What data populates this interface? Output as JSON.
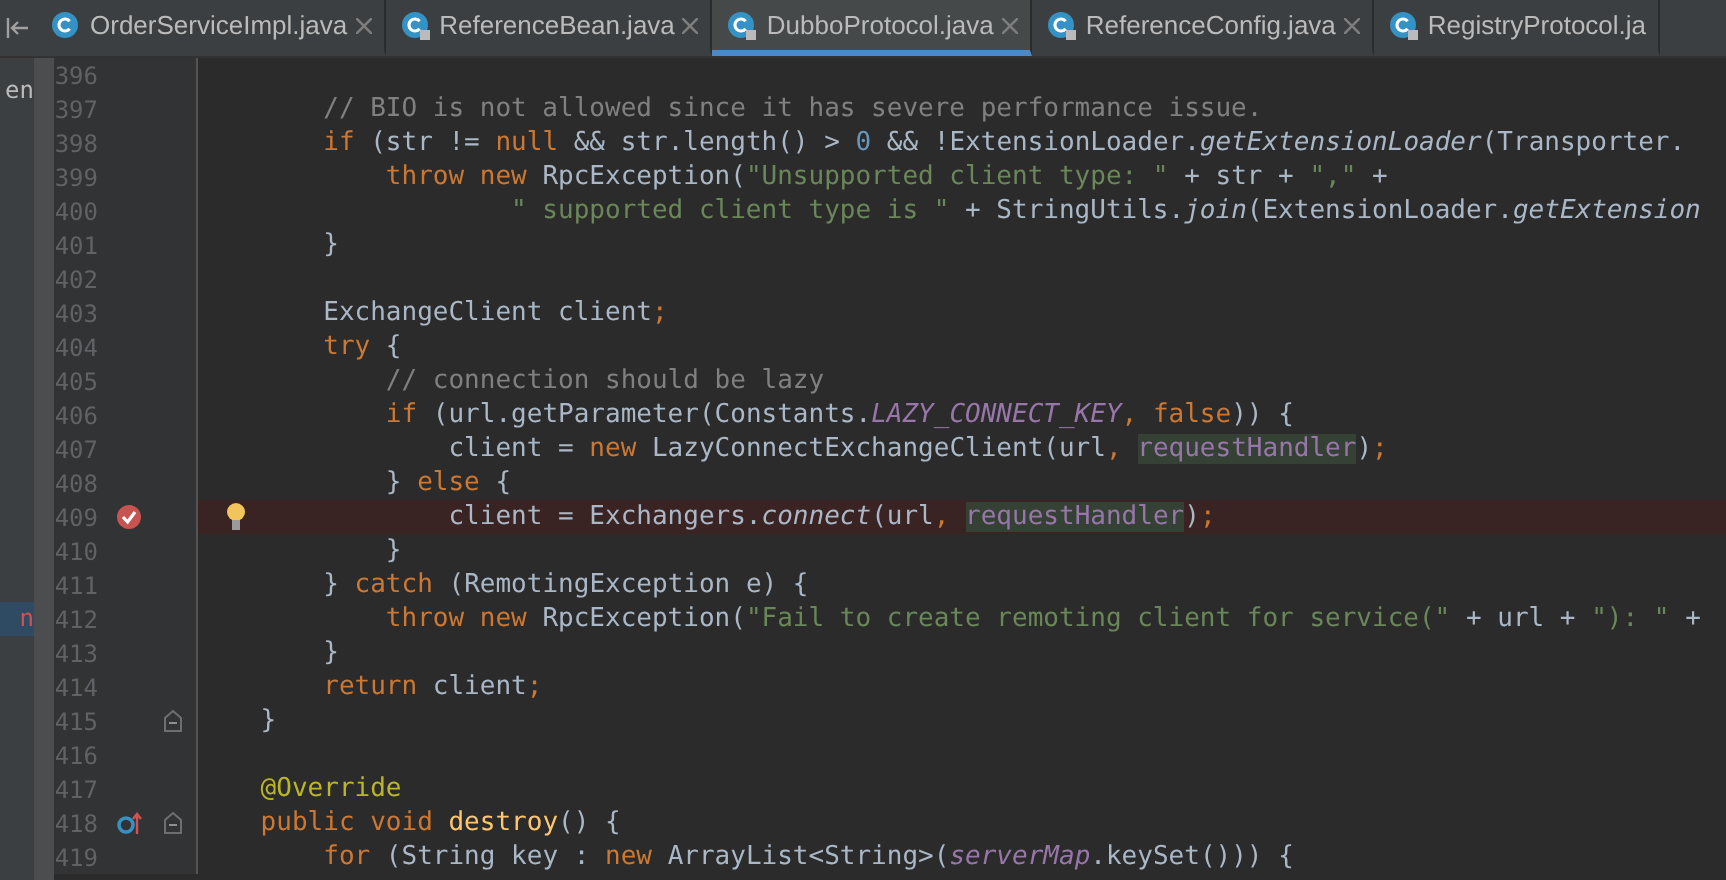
{
  "tabs": [
    {
      "label": "OrderServiceImpl.java",
      "locked": false,
      "selected": false
    },
    {
      "label": "ReferenceBean.java",
      "locked": true,
      "selected": false
    },
    {
      "label": "DubboProtocol.java",
      "locked": true,
      "selected": true
    },
    {
      "label": "ReferenceConfig.java",
      "locked": true,
      "selected": false
    },
    {
      "label": "RegistryProtocol.ja",
      "locked": true,
      "selected": false
    }
  ],
  "project_panel": {
    "items": [
      {
        "text": "en",
        "selected": false
      },
      {
        "text": "n",
        "selected": true
      }
    ]
  },
  "lines": [
    {
      "number": "396"
    },
    {
      "number": "397",
      "tokens": [
        {
          "kind": "comment",
          "text": "        // BIO is not allowed since it has severe performance issue."
        }
      ]
    },
    {
      "number": "398",
      "tokens": [
        {
          "kind": "keyword",
          "text": "        if "
        },
        {
          "kind": "plain",
          "text": "(str != "
        },
        {
          "kind": "keyword",
          "text": "null "
        },
        {
          "kind": "plain",
          "text": "&& str.length() > "
        },
        {
          "kind": "number",
          "text": "0 "
        },
        {
          "kind": "plain",
          "text": "&& !ExtensionLoader."
        },
        {
          "kind": "static",
          "text": "getExtensionLoader"
        },
        {
          "kind": "plain",
          "text": "(Transporter."
        }
      ]
    },
    {
      "number": "399",
      "tokens": [
        {
          "kind": "keyword",
          "text": "            throw new "
        },
        {
          "kind": "plain",
          "text": "RpcException("
        },
        {
          "kind": "string",
          "text": "\"Unsupported client type: \" "
        },
        {
          "kind": "plain",
          "text": "+ str + "
        },
        {
          "kind": "string",
          "text": "\",\" "
        },
        {
          "kind": "plain",
          "text": "+"
        }
      ]
    },
    {
      "number": "400",
      "tokens": [
        {
          "kind": "string",
          "text": "                    \" supported client type is \" "
        },
        {
          "kind": "plain",
          "text": "+ StringUtils."
        },
        {
          "kind": "static",
          "text": "join"
        },
        {
          "kind": "plain",
          "text": "(ExtensionLoader."
        },
        {
          "kind": "static",
          "text": "getExtension"
        }
      ]
    },
    {
      "number": "401",
      "tokens": [
        {
          "kind": "plain",
          "text": "        }"
        }
      ]
    },
    {
      "number": "402"
    },
    {
      "number": "403",
      "tokens": [
        {
          "kind": "plain",
          "text": "        ExchangeClient client"
        },
        {
          "kind": "keyword",
          "text": ";"
        }
      ]
    },
    {
      "number": "404",
      "tokens": [
        {
          "kind": "keyword",
          "text": "        try "
        },
        {
          "kind": "plain",
          "text": "{"
        }
      ]
    },
    {
      "number": "405",
      "tokens": [
        {
          "kind": "comment",
          "text": "            // connection should be lazy"
        }
      ]
    },
    {
      "number": "406",
      "tokens": [
        {
          "kind": "keyword",
          "text": "            if "
        },
        {
          "kind": "plain",
          "text": "(url.getParameter(Constants."
        },
        {
          "kind": "constant",
          "text": "LAZY_CONNECT_KEY"
        },
        {
          "kind": "keyword",
          "text": ", false"
        },
        {
          "kind": "plain",
          "text": ")) {"
        }
      ]
    },
    {
      "number": "407",
      "tokens": [
        {
          "kind": "plain",
          "text": "                client = "
        },
        {
          "kind": "keyword",
          "text": "new "
        },
        {
          "kind": "plain",
          "text": "LazyConnectExchangeClient(url"
        },
        {
          "kind": "keyword",
          "text": ", "
        },
        {
          "kind": "usage",
          "text": "requestHandler"
        },
        {
          "kind": "plain",
          "text": ")"
        },
        {
          "kind": "keyword",
          "text": ";"
        }
      ]
    },
    {
      "number": "408",
      "tokens": [
        {
          "kind": "plain",
          "text": "            } "
        },
        {
          "kind": "keyword",
          "text": "else "
        },
        {
          "kind": "plain",
          "text": "{"
        }
      ]
    },
    {
      "number": "409",
      "tokens": [
        {
          "kind": "plain",
          "text": "                client = Exchangers."
        },
        {
          "kind": "static",
          "text": "connect"
        },
        {
          "kind": "plain",
          "text": "(url"
        },
        {
          "kind": "keyword",
          "text": ", "
        },
        {
          "kind": "usage",
          "text": "requestHandler"
        },
        {
          "kind": "plain",
          "text": ")"
        },
        {
          "kind": "keyword",
          "text": ";"
        }
      ],
      "gutter_icons": [
        {
          "kind": "breakpoint"
        },
        {
          "kind": "bulb"
        }
      ],
      "highlighted": true
    },
    {
      "number": "410",
      "tokens": [
        {
          "kind": "plain",
          "text": "            }"
        }
      ]
    },
    {
      "number": "411",
      "tokens": [
        {
          "kind": "plain",
          "text": "        } "
        },
        {
          "kind": "keyword",
          "text": "catch "
        },
        {
          "kind": "plain",
          "text": "(RemotingException e) {"
        }
      ]
    },
    {
      "number": "412",
      "tokens": [
        {
          "kind": "keyword",
          "text": "            throw new "
        },
        {
          "kind": "plain",
          "text": "RpcException("
        },
        {
          "kind": "string",
          "text": "\"Fail to create remoting client for service(\" "
        },
        {
          "kind": "plain",
          "text": "+ url + "
        },
        {
          "kind": "string",
          "text": "\"): \" "
        },
        {
          "kind": "plain",
          "text": "+"
        }
      ]
    },
    {
      "number": "413",
      "tokens": [
        {
          "kind": "plain",
          "text": "        }"
        }
      ]
    },
    {
      "number": "414",
      "tokens": [
        {
          "kind": "keyword",
          "text": "        return "
        },
        {
          "kind": "plain",
          "text": "client"
        },
        {
          "kind": "keyword",
          "text": ";"
        }
      ]
    },
    {
      "number": "415",
      "tokens": [
        {
          "kind": "plain",
          "text": "    }"
        }
      ],
      "gutter_icons": [
        {
          "kind": "fold"
        }
      ]
    },
    {
      "number": "416"
    },
    {
      "number": "417",
      "tokens": [
        {
          "kind": "annotation",
          "text": "    @Override"
        }
      ]
    },
    {
      "number": "418",
      "tokens": [
        {
          "kind": "keyword",
          "text": "    public void "
        },
        {
          "kind": "method",
          "text": "destroy"
        },
        {
          "kind": "plain",
          "text": "() {"
        }
      ],
      "gutter_icons": [
        {
          "kind": "override"
        },
        {
          "kind": "fold"
        }
      ]
    },
    {
      "number": "419",
      "tokens": [
        {
          "kind": "keyword",
          "text": "        for "
        },
        {
          "kind": "plain",
          "text": "(String key : "
        },
        {
          "kind": "keyword",
          "text": "new "
        },
        {
          "kind": "plain",
          "text": "ArrayList<String>("
        },
        {
          "kind": "constant",
          "text": "serverMap"
        },
        {
          "kind": "plain",
          "text": ".keySet())) {"
        }
      ]
    }
  ]
}
